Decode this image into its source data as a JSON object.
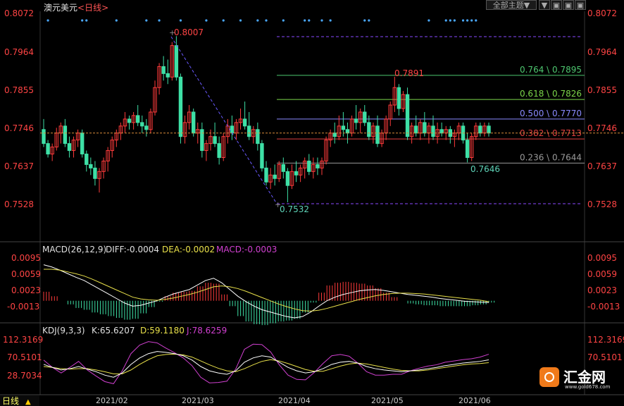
{
  "header": {
    "title": "澳元美元",
    "period": "<日线>",
    "theme_button": "全部主题▼",
    "win_buttons": [
      "▼",
      "▣",
      "▣",
      "▣"
    ]
  },
  "price_axis": {
    "ticks": [
      "0.8072",
      "0.7964",
      "0.7855",
      "0.7746",
      "0.7637",
      "0.7528"
    ],
    "right_ticks": [
      "0.8072",
      "0.7964",
      "0.7855",
      "0.7746",
      "0.7637",
      "0.7528"
    ]
  },
  "annotations": {
    "high": "0.8007",
    "low": "0.7532",
    "swing_high": "0.7891",
    "swing_low": "0.7646"
  },
  "fib_levels": [
    {
      "label": "0.764 \\ 0.7895",
      "price": 0.7895,
      "color": "#4ec870"
    },
    {
      "label": "0.618 \\ 0.7826",
      "price": 0.7826,
      "color": "#7cd64a"
    },
    {
      "label": "0.500 \\ 0.7770",
      "price": 0.777,
      "color": "#8a8aff"
    },
    {
      "label": "0.382 \\ 0.7713",
      "price": 0.7713,
      "color": "#e04040"
    },
    {
      "label": "0.236 \\ 0.7644",
      "price": 0.7644,
      "color": "#9a9a9a"
    }
  ],
  "macd": {
    "title": "MACD(26,12,9)",
    "diff": "DIFF:-0.0004",
    "dea": "DEA:-0.0002",
    "macd": "MACD:-0.0003",
    "ticks": [
      "0.0095",
      "0.0059",
      "0.0023",
      "-0.0013"
    ]
  },
  "kdj": {
    "title": "KDJ(9,3,3)",
    "k": "K:65.6207",
    "d": "D:59.1180",
    "j": "J:78.6259",
    "ticks": [
      "112.3169",
      "70.5101",
      "28.7034"
    ]
  },
  "date_axis": {
    "period_tag": "日线",
    "labels": [
      "2021/02",
      "2021/03",
      "2021/04",
      "2021/05",
      "2021/06"
    ]
  },
  "watermark": {
    "brand": "汇金网",
    "url": "www.gold678.com"
  },
  "chart_data": {
    "type": "candlestick",
    "symbol": "AUDUSD",
    "ylim": [
      0.748,
      0.8072
    ],
    "current_price": 0.773,
    "candles_ohlc": [
      [
        0.774,
        0.777,
        0.769,
        0.77
      ],
      [
        0.77,
        0.771,
        0.766,
        0.767
      ],
      [
        0.767,
        0.77,
        0.765,
        0.769
      ],
      [
        0.769,
        0.7745,
        0.768,
        0.773
      ],
      [
        0.773,
        0.776,
        0.77,
        0.775
      ],
      [
        0.775,
        0.777,
        0.769,
        0.77
      ],
      [
        0.77,
        0.772,
        0.766,
        0.768
      ],
      [
        0.768,
        0.772,
        0.766,
        0.771
      ],
      [
        0.771,
        0.774,
        0.769,
        0.773
      ],
      [
        0.773,
        0.774,
        0.766,
        0.767
      ],
      [
        0.767,
        0.768,
        0.762,
        0.764
      ],
      [
        0.764,
        0.766,
        0.761,
        0.763
      ],
      [
        0.763,
        0.765,
        0.758,
        0.76
      ],
      [
        0.76,
        0.763,
        0.756,
        0.762
      ],
      [
        0.762,
        0.766,
        0.76,
        0.765
      ],
      [
        0.765,
        0.769,
        0.762,
        0.768
      ],
      [
        0.768,
        0.772,
        0.766,
        0.771
      ],
      [
        0.771,
        0.774,
        0.769,
        0.773
      ],
      [
        0.773,
        0.776,
        0.771,
        0.775
      ],
      [
        0.775,
        0.779,
        0.773,
        0.777
      ],
      [
        0.777,
        0.778,
        0.774,
        0.776
      ],
      [
        0.776,
        0.779,
        0.774,
        0.778
      ],
      [
        0.778,
        0.781,
        0.775,
        0.776
      ],
      [
        0.776,
        0.778,
        0.773,
        0.775
      ],
      [
        0.775,
        0.777,
        0.772,
        0.774
      ],
      [
        0.774,
        0.78,
        0.773,
        0.779
      ],
      [
        0.779,
        0.788,
        0.778,
        0.786
      ],
      [
        0.786,
        0.793,
        0.784,
        0.792
      ],
      [
        0.792,
        0.795,
        0.788,
        0.79
      ],
      [
        0.79,
        0.794,
        0.787,
        0.789
      ],
      [
        0.789,
        0.799,
        0.788,
        0.798
      ],
      [
        0.798,
        0.8007,
        0.788,
        0.789
      ],
      [
        0.789,
        0.79,
        0.77,
        0.772
      ],
      [
        0.772,
        0.778,
        0.77,
        0.776
      ],
      [
        0.776,
        0.781,
        0.774,
        0.779
      ],
      [
        0.779,
        0.78,
        0.772,
        0.773
      ],
      [
        0.773,
        0.776,
        0.77,
        0.774
      ],
      [
        0.774,
        0.776,
        0.766,
        0.768
      ],
      [
        0.768,
        0.771,
        0.765,
        0.77
      ],
      [
        0.77,
        0.774,
        0.768,
        0.772
      ],
      [
        0.772,
        0.776,
        0.769,
        0.77
      ],
      [
        0.77,
        0.772,
        0.764,
        0.766
      ],
      [
        0.766,
        0.773,
        0.765,
        0.772
      ],
      [
        0.772,
        0.777,
        0.77,
        0.775
      ],
      [
        0.775,
        0.778,
        0.771,
        0.773
      ],
      [
        0.773,
        0.777,
        0.771,
        0.776
      ],
      [
        0.776,
        0.78,
        0.774,
        0.777
      ],
      [
        0.777,
        0.782,
        0.774,
        0.775
      ],
      [
        0.775,
        0.779,
        0.771,
        0.772
      ],
      [
        0.772,
        0.775,
        0.77,
        0.774
      ],
      [
        0.774,
        0.776,
        0.768,
        0.77
      ],
      [
        0.77,
        0.771,
        0.762,
        0.763
      ],
      [
        0.763,
        0.765,
        0.758,
        0.759
      ],
      [
        0.759,
        0.763,
        0.757,
        0.761
      ],
      [
        0.761,
        0.764,
        0.758,
        0.76
      ],
      [
        0.76,
        0.765,
        0.759,
        0.764
      ],
      [
        0.764,
        0.766,
        0.76,
        0.762
      ],
      [
        0.762,
        0.763,
        0.7532,
        0.758
      ],
      [
        0.758,
        0.764,
        0.757,
        0.762
      ],
      [
        0.762,
        0.765,
        0.759,
        0.761
      ],
      [
        0.761,
        0.764,
        0.759,
        0.763
      ],
      [
        0.763,
        0.766,
        0.76,
        0.765
      ],
      [
        0.765,
        0.767,
        0.761,
        0.762
      ],
      [
        0.762,
        0.766,
        0.76,
        0.764
      ],
      [
        0.764,
        0.766,
        0.761,
        0.763
      ],
      [
        0.763,
        0.766,
        0.761,
        0.765
      ],
      [
        0.765,
        0.772,
        0.764,
        0.771
      ],
      [
        0.771,
        0.774,
        0.769,
        0.773
      ],
      [
        0.773,
        0.776,
        0.77,
        0.772
      ],
      [
        0.772,
        0.778,
        0.771,
        0.775
      ],
      [
        0.775,
        0.779,
        0.772,
        0.774
      ],
      [
        0.774,
        0.776,
        0.77,
        0.773
      ],
      [
        0.773,
        0.778,
        0.772,
        0.777
      ],
      [
        0.777,
        0.781,
        0.774,
        0.776
      ],
      [
        0.776,
        0.78,
        0.773,
        0.779
      ],
      [
        0.779,
        0.781,
        0.775,
        0.776
      ],
      [
        0.776,
        0.778,
        0.771,
        0.772
      ],
      [
        0.772,
        0.776,
        0.77,
        0.775
      ],
      [
        0.775,
        0.778,
        0.769,
        0.77
      ],
      [
        0.77,
        0.774,
        0.769,
        0.773
      ],
      [
        0.773,
        0.778,
        0.771,
        0.777
      ],
      [
        0.777,
        0.782,
        0.775,
        0.781
      ],
      [
        0.781,
        0.7891,
        0.779,
        0.786
      ],
      [
        0.786,
        0.787,
        0.778,
        0.78
      ],
      [
        0.78,
        0.785,
        0.779,
        0.784
      ],
      [
        0.784,
        0.786,
        0.771,
        0.772
      ],
      [
        0.772,
        0.776,
        0.77,
        0.775
      ],
      [
        0.775,
        0.778,
        0.772,
        0.773
      ],
      [
        0.773,
        0.777,
        0.771,
        0.776
      ],
      [
        0.776,
        0.779,
        0.772,
        0.773
      ],
      [
        0.773,
        0.776,
        0.77,
        0.775
      ],
      [
        0.775,
        0.778,
        0.771,
        0.772
      ],
      [
        0.772,
        0.776,
        0.77,
        0.774
      ],
      [
        0.774,
        0.776,
        0.772,
        0.773
      ],
      [
        0.773,
        0.775,
        0.771,
        0.774
      ],
      [
        0.774,
        0.775,
        0.77,
        0.772
      ],
      [
        0.772,
        0.774,
        0.769,
        0.773
      ],
      [
        0.773,
        0.776,
        0.771,
        0.775
      ],
      [
        0.775,
        0.776,
        0.77,
        0.771
      ],
      [
        0.771,
        0.773,
        0.7646,
        0.766
      ],
      [
        0.766,
        0.773,
        0.765,
        0.772
      ],
      [
        0.772,
        0.776,
        0.771,
        0.775
      ],
      [
        0.775,
        0.776,
        0.772,
        0.773
      ],
      [
        0.773,
        0.776,
        0.772,
        0.775
      ],
      [
        0.775,
        0.776,
        0.772,
        0.773
      ]
    ],
    "macd_series": {
      "diff": [
        0.008,
        0.0075,
        0.0068,
        0.006,
        0.0052,
        0.0045,
        0.0035,
        0.0025,
        0.0015,
        0.0005,
        -0.0005,
        -0.0012,
        -0.001,
        -0.0005,
        0.0,
        0.0008,
        0.0015,
        0.002,
        0.0025,
        0.0035,
        0.0045,
        0.005,
        0.004,
        0.0025,
        0.001,
        -0.0002,
        -0.0012,
        -0.002,
        -0.0025,
        -0.003,
        -0.0035,
        -0.0038,
        -0.0035,
        -0.0025,
        -0.0012,
        0.0,
        0.0008,
        0.0014,
        0.0018,
        0.0022,
        0.0024,
        0.0025,
        0.0023,
        0.002,
        0.0017,
        0.0014,
        0.0012,
        0.001,
        0.0008,
        0.0005,
        0.0003,
        0.0001,
        -0.0001,
        -0.0002,
        -0.0003,
        -0.0004
      ],
      "dea": [
        0.007,
        0.007,
        0.0068,
        0.0064,
        0.006,
        0.0055,
        0.0048,
        0.004,
        0.0032,
        0.0024,
        0.0016,
        0.0008,
        0.0004,
        0.0002,
        0.0001,
        0.0003,
        0.0006,
        0.001,
        0.0014,
        0.0019,
        0.0025,
        0.0031,
        0.0033,
        0.0031,
        0.0027,
        0.0021,
        0.0014,
        0.0007,
        0.0,
        -0.0007,
        -0.0013,
        -0.0018,
        -0.0022,
        -0.0023,
        -0.0021,
        -0.0017,
        -0.0012,
        -0.0007,
        -0.0002,
        0.0003,
        0.0007,
        0.0011,
        0.0014,
        0.0016,
        0.0017,
        0.0017,
        0.0016,
        0.0015,
        0.0013,
        0.0011,
        0.0009,
        0.0007,
        0.0005,
        0.0003,
        0.0001,
        -0.0002
      ]
    },
    "kdj_series": {
      "k": [
        55,
        48,
        42,
        45,
        50,
        44,
        38,
        30,
        25,
        35,
        55,
        70,
        80,
        85,
        83,
        80,
        75,
        65,
        50,
        40,
        35,
        32,
        40,
        60,
        70,
        75,
        72,
        60,
        48,
        40,
        35,
        38,
        45,
        55,
        60,
        62,
        58,
        50,
        45,
        42,
        40,
        38,
        40,
        42,
        45,
        48,
        52,
        55,
        58,
        60,
        62,
        65.6
      ],
      "d": [
        50,
        48,
        45,
        44,
        45,
        45,
        42,
        38,
        33,
        33,
        42,
        55,
        66,
        75,
        78,
        79,
        77,
        72,
        63,
        54,
        46,
        40,
        38,
        45,
        54,
        62,
        66,
        63,
        57,
        50,
        43,
        39,
        39,
        45,
        51,
        56,
        58,
        56,
        52,
        48,
        44,
        41,
        40,
        40,
        42,
        45,
        48,
        51,
        54,
        56,
        57,
        59.1
      ],
      "j": [
        65,
        48,
        35,
        48,
        62,
        42,
        28,
        15,
        10,
        40,
        80,
        100,
        108,
        105,
        93,
        82,
        70,
        52,
        25,
        12,
        13,
        16,
        44,
        90,
        102,
        101,
        84,
        54,
        30,
        20,
        19,
        36,
        57,
        75,
        78,
        74,
        58,
        38,
        30,
        30,
        32,
        32,
        40,
        46,
        51,
        54,
        60,
        63,
        66,
        68,
        72,
        78.6
      ]
    }
  }
}
